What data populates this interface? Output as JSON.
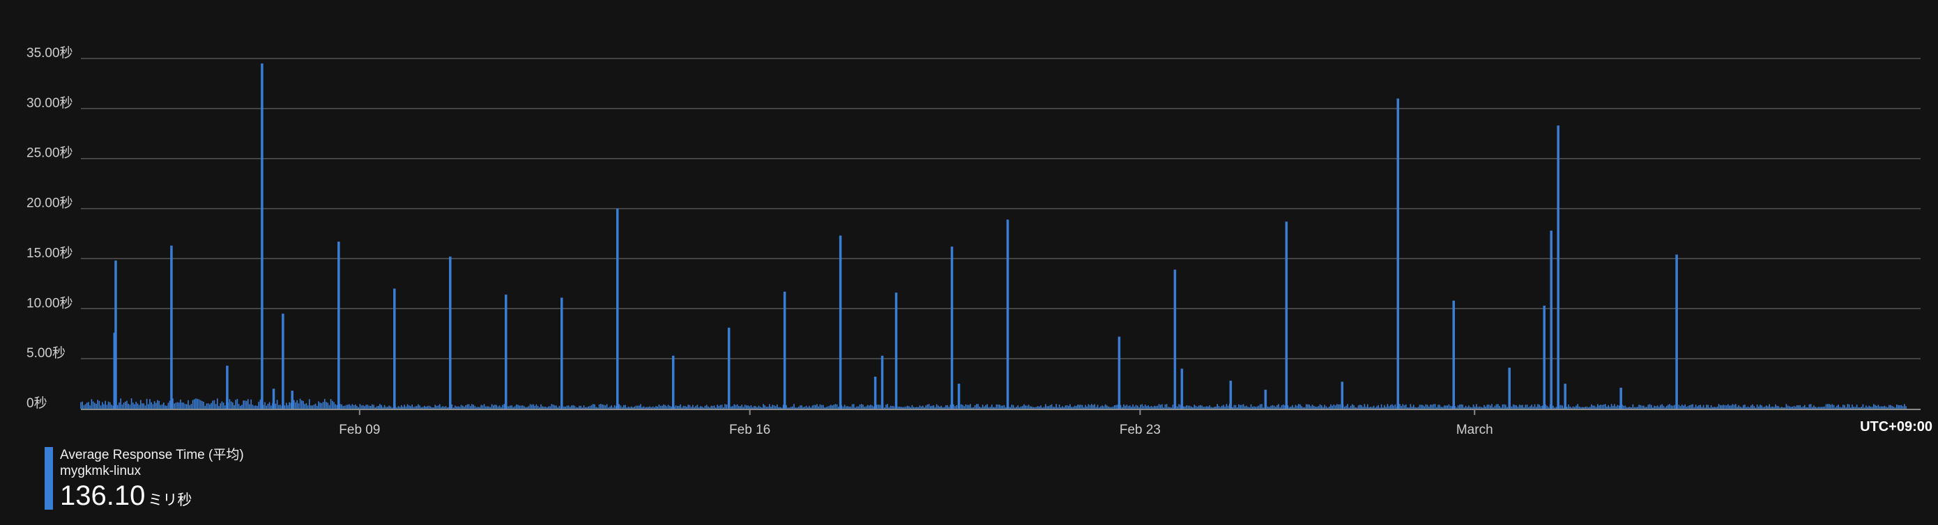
{
  "colors": {
    "background": "#131313",
    "series": "#3a7fd5",
    "grid": "#555555"
  },
  "timezone": "UTC+09:00",
  "legend": {
    "name": "Average Response Time (平均)",
    "host": "mygkmk-linux",
    "value": "136.10",
    "unit": "ミリ秒"
  },
  "chart_data": {
    "type": "bar",
    "title": "",
    "xlabel": "",
    "ylabel": "",
    "ylim": [
      0,
      35
    ],
    "yticks": [
      0,
      5,
      10,
      15,
      20,
      25,
      30,
      35
    ],
    "yticklabels": [
      "0秒",
      "5.00秒",
      "10.00秒",
      "15.00秒",
      "20.00秒",
      "25.00秒",
      "30.00秒",
      "35.00秒"
    ],
    "xlim": [
      "2026-02-04",
      "2026-03-09"
    ],
    "xticks": [
      "2026-02-09",
      "2026-02-16",
      "2026-02-23",
      "2026-03-01"
    ],
    "xticklabels": [
      "Feb 09",
      "Feb 16",
      "Feb 23",
      "March"
    ],
    "baseline_level_s": 0.3,
    "series": [
      {
        "name": "mygkmk-linux",
        "unit": "seconds",
        "spikes": [
          {
            "t": "2026-02-04T14:30",
            "v": 7.6
          },
          {
            "t": "2026-02-04T15:00",
            "v": 14.8
          },
          {
            "t": "2026-02-05T15:00",
            "v": 16.3
          },
          {
            "t": "2026-02-06T15:00",
            "v": 4.3
          },
          {
            "t": "2026-02-07T06:00",
            "v": 34.5
          },
          {
            "t": "2026-02-07T11:00",
            "v": 2.0
          },
          {
            "t": "2026-02-07T15:00",
            "v": 9.5
          },
          {
            "t": "2026-02-07T19:00",
            "v": 1.8
          },
          {
            "t": "2026-02-08T15:00",
            "v": 16.7
          },
          {
            "t": "2026-02-09T15:00",
            "v": 12.0
          },
          {
            "t": "2026-02-10T15:00",
            "v": 15.2
          },
          {
            "t": "2026-02-11T15:00",
            "v": 11.4
          },
          {
            "t": "2026-02-12T15:00",
            "v": 11.1
          },
          {
            "t": "2026-02-13T15:00",
            "v": 20.0
          },
          {
            "t": "2026-02-14T15:00",
            "v": 5.3
          },
          {
            "t": "2026-02-15T15:00",
            "v": 8.1
          },
          {
            "t": "2026-02-16T15:00",
            "v": 11.7
          },
          {
            "t": "2026-02-17T15:00",
            "v": 17.3
          },
          {
            "t": "2026-02-18T06:00",
            "v": 3.2
          },
          {
            "t": "2026-02-18T09:00",
            "v": 5.3
          },
          {
            "t": "2026-02-18T15:00",
            "v": 11.6
          },
          {
            "t": "2026-02-19T15:00",
            "v": 16.2
          },
          {
            "t": "2026-02-19T18:00",
            "v": 2.5
          },
          {
            "t": "2026-02-20T15:00",
            "v": 18.9
          },
          {
            "t": "2026-02-22T15:00",
            "v": 7.2
          },
          {
            "t": "2026-02-23T15:00",
            "v": 13.9
          },
          {
            "t": "2026-02-23T18:00",
            "v": 4.0
          },
          {
            "t": "2026-02-24T15:00",
            "v": 2.8
          },
          {
            "t": "2026-02-25T06:00",
            "v": 1.9
          },
          {
            "t": "2026-02-25T15:00",
            "v": 18.7
          },
          {
            "t": "2026-02-26T15:00",
            "v": 2.7
          },
          {
            "t": "2026-02-27T15:00",
            "v": 31.0
          },
          {
            "t": "2026-02-28T15:00",
            "v": 10.8
          },
          {
            "t": "2026-03-01T15:00",
            "v": 4.1
          },
          {
            "t": "2026-03-02T06:00",
            "v": 10.3
          },
          {
            "t": "2026-03-02T09:00",
            "v": 17.8
          },
          {
            "t": "2026-03-02T12:00",
            "v": 28.3
          },
          {
            "t": "2026-03-02T15:00",
            "v": 2.5
          },
          {
            "t": "2026-03-03T15:00",
            "v": 2.1
          },
          {
            "t": "2026-03-04T15:00",
            "v": 15.4
          }
        ]
      }
    ]
  }
}
